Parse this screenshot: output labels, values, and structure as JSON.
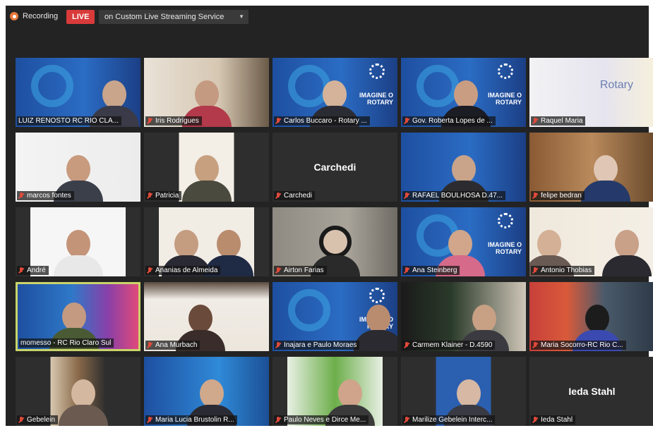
{
  "topbar": {
    "recording_label": "Recording",
    "live_badge": "LIVE",
    "stream_service": "on Custom Live Streaming Service"
  },
  "overlay_text": {
    "rotary": "Rotary",
    "imagine_line1": "IMAGINE O",
    "imagine_line2": "ROTARY"
  },
  "colors": {
    "live_red": "#d93a3a",
    "active_speaker_border": "#c9d46a",
    "muted_mic": "#e04a3a",
    "rotary_blue": "#1e4fa0"
  },
  "participants": [
    {
      "name": "LUIZ RENOSTO RC RIO CLA...",
      "muted": false
    },
    {
      "name": "Iris Rodrigues",
      "muted": true
    },
    {
      "name": "Carlos Buccaro - Rotary ...",
      "muted": true
    },
    {
      "name": "Gov. Roberta Lopes de ...",
      "muted": true
    },
    {
      "name": "Raquel Maria",
      "muted": true
    },
    {
      "name": "marcos fontes",
      "muted": true
    },
    {
      "name": "Patricia",
      "muted": true
    },
    {
      "name": "Carchedi",
      "muted": true,
      "center_label": "Carchedi"
    },
    {
      "name": "RAFAEL BOULHOSA D.47...",
      "muted": true
    },
    {
      "name": "felipe bedran",
      "muted": true
    },
    {
      "name": "André",
      "muted": true
    },
    {
      "name": "Ananias de Almeida",
      "muted": true
    },
    {
      "name": "Airton Farias",
      "muted": true
    },
    {
      "name": "Ana Steinberg",
      "muted": true
    },
    {
      "name": "Antonio Thobias",
      "muted": true
    },
    {
      "name": "momesso - RC Rio Claro Sul",
      "muted": false,
      "active": true
    },
    {
      "name": "Ana Murbach",
      "muted": true
    },
    {
      "name": "Inajara e Paulo Moraes",
      "muted": true
    },
    {
      "name": "Carmem Klainer - D.4590",
      "muted": true
    },
    {
      "name": "Maria Socorro-RC Rio C...",
      "muted": true
    },
    {
      "name": "Gebelein",
      "muted": true
    },
    {
      "name": "Maria Lucia Brustolin R...",
      "muted": true
    },
    {
      "name": "Paulo Neves e Dirce Me...",
      "muted": true
    },
    {
      "name": "Marilize Gebelein Interc...",
      "muted": true
    },
    {
      "name": "Ieda Stahl",
      "muted": true,
      "center_label": "Ieda Stahl"
    }
  ]
}
